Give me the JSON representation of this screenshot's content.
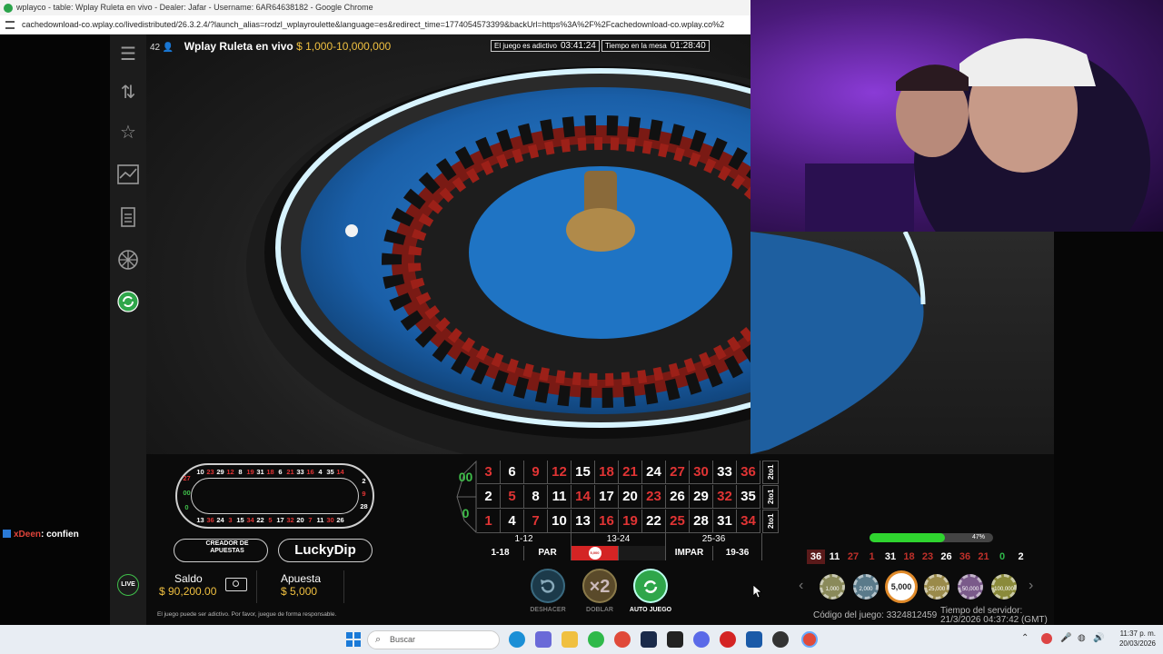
{
  "window": {
    "title": "wplayco - table: Wplay Ruleta en vivo - Dealer: Jafar - Username: 6AR64638182 - Google Chrome",
    "url": "cachedownload-co.wplay.co/livedistributed/26.3.2.4/?launch_alias=rodzl_wplayroulette&language=es&redirect_time=1774054573399&backUrl=https%3A%2F%2Fcachedownload-co.wplay.co%2"
  },
  "chat": {
    "user": "xDeen",
    "message": ": confien"
  },
  "header": {
    "players": "42",
    "title": "Wplay Ruleta en vivo",
    "limits": "$ 1,000-10,000,000",
    "timer1_label": "El juego es adictivo",
    "timer1_value": "03:41:24",
    "timer2_label": "Tiempo en la mesa",
    "timer2_value": "01:28:40"
  },
  "nav_icons": [
    "menu-icon",
    "sort-icon",
    "star-icon",
    "chart-icon",
    "document-icon",
    "wheel-icon",
    "autoplay-icon"
  ],
  "racetrack": {
    "top": [
      "10",
      "23",
      "29",
      "12",
      "8",
      "19",
      "31",
      "18",
      "6",
      "21",
      "33",
      "16",
      "4",
      "35",
      "14"
    ],
    "bottom": [
      "13",
      "36",
      "24",
      "3",
      "15",
      "34",
      "22",
      "5",
      "17",
      "32",
      "20",
      "7",
      "11",
      "30",
      "26"
    ],
    "right": [
      "2",
      "9",
      "28"
    ],
    "left": [
      "27",
      "00",
      "0"
    ]
  },
  "buttons": {
    "builder": "CREADOR DE APUESTAS",
    "luckydip": "LuckyDip"
  },
  "balance": {
    "live_badge": "LIVE",
    "saldo_label": "Saldo",
    "saldo_value": "$ 90,200.00",
    "apuesta_label": "Apuesta",
    "apuesta_value": "$ 5,000"
  },
  "disclaimer": "El juego puede ser adictivo. Por favor, juegue de forma responsable.",
  "grid": {
    "zeros": [
      "00",
      "0"
    ],
    "rows": [
      [
        {
          "n": "3",
          "c": "red"
        },
        {
          "n": "6",
          "c": "black"
        },
        {
          "n": "9",
          "c": "red"
        },
        {
          "n": "12",
          "c": "red"
        },
        {
          "n": "15",
          "c": "black"
        },
        {
          "n": "18",
          "c": "red"
        },
        {
          "n": "21",
          "c": "red"
        },
        {
          "n": "24",
          "c": "black"
        },
        {
          "n": "27",
          "c": "red"
        },
        {
          "n": "30",
          "c": "red"
        },
        {
          "n": "33",
          "c": "black"
        },
        {
          "n": "36",
          "c": "red"
        }
      ],
      [
        {
          "n": "2",
          "c": "black"
        },
        {
          "n": "5",
          "c": "red"
        },
        {
          "n": "8",
          "c": "black"
        },
        {
          "n": "11",
          "c": "black"
        },
        {
          "n": "14",
          "c": "red"
        },
        {
          "n": "17",
          "c": "black"
        },
        {
          "n": "20",
          "c": "black"
        },
        {
          "n": "23",
          "c": "red"
        },
        {
          "n": "26",
          "c": "black"
        },
        {
          "n": "29",
          "c": "black"
        },
        {
          "n": "32",
          "c": "red"
        },
        {
          "n": "35",
          "c": "black"
        }
      ],
      [
        {
          "n": "1",
          "c": "red"
        },
        {
          "n": "4",
          "c": "black"
        },
        {
          "n": "7",
          "c": "red"
        },
        {
          "n": "10",
          "c": "black"
        },
        {
          "n": "13",
          "c": "black"
        },
        {
          "n": "16",
          "c": "red"
        },
        {
          "n": "19",
          "c": "red"
        },
        {
          "n": "22",
          "c": "black"
        },
        {
          "n": "25",
          "c": "red"
        },
        {
          "n": "28",
          "c": "black"
        },
        {
          "n": "31",
          "c": "black"
        },
        {
          "n": "34",
          "c": "red"
        }
      ]
    ],
    "column_bet": "2to1",
    "dozens": [
      "1-12",
      "13-24",
      "25-36"
    ],
    "outside": [
      "1-18",
      "PAR",
      "",
      "",
      "IMPAR",
      "19-36"
    ],
    "red_chip_label": "5,000"
  },
  "actions": {
    "undo": "DESHACER",
    "double": "DOBLAR",
    "double_symbol": "×2",
    "autoplay": "AUTO JUEGO"
  },
  "progress": {
    "percent_label": "47%",
    "fill_fraction": 0.47
  },
  "history": [
    {
      "n": "36",
      "c": "#ffffff",
      "hl": true
    },
    {
      "n": "11",
      "c": "#ffffff"
    },
    {
      "n": "27",
      "c": "#c0302a"
    },
    {
      "n": "1",
      "c": "#c0302a"
    },
    {
      "n": "31",
      "c": "#ffffff"
    },
    {
      "n": "18",
      "c": "#c0302a"
    },
    {
      "n": "23",
      "c": "#c0302a"
    },
    {
      "n": "26",
      "c": "#ffffff"
    },
    {
      "n": "36",
      "c": "#c0302a"
    },
    {
      "n": "21",
      "c": "#c0302a"
    },
    {
      "n": "0",
      "c": "#2fb94a"
    },
    {
      "n": "2",
      "c": "#ffffff"
    }
  ],
  "chips": [
    {
      "label": "1,000",
      "color": "#8a8a5a"
    },
    {
      "label": "2,000",
      "color": "#5a7a8a"
    },
    {
      "label": "5,000",
      "color": "#ffffff",
      "selected": true
    },
    {
      "label": "25,000",
      "color": "#9a8a4a"
    },
    {
      "label": "50,000",
      "color": "#7a5a8a"
    },
    {
      "label": "100,000",
      "color": "#8a8a3a"
    }
  ],
  "footer": {
    "game_code": "Código del juego: 3324812459",
    "server_time_label": "Tiempo del servidor:",
    "server_time_value": "21/3/2026 04:37:42 (GMT)"
  },
  "taskbar": {
    "search_placeholder": "Buscar",
    "time": "11:37 p. m.",
    "date": "20/03/2026"
  }
}
